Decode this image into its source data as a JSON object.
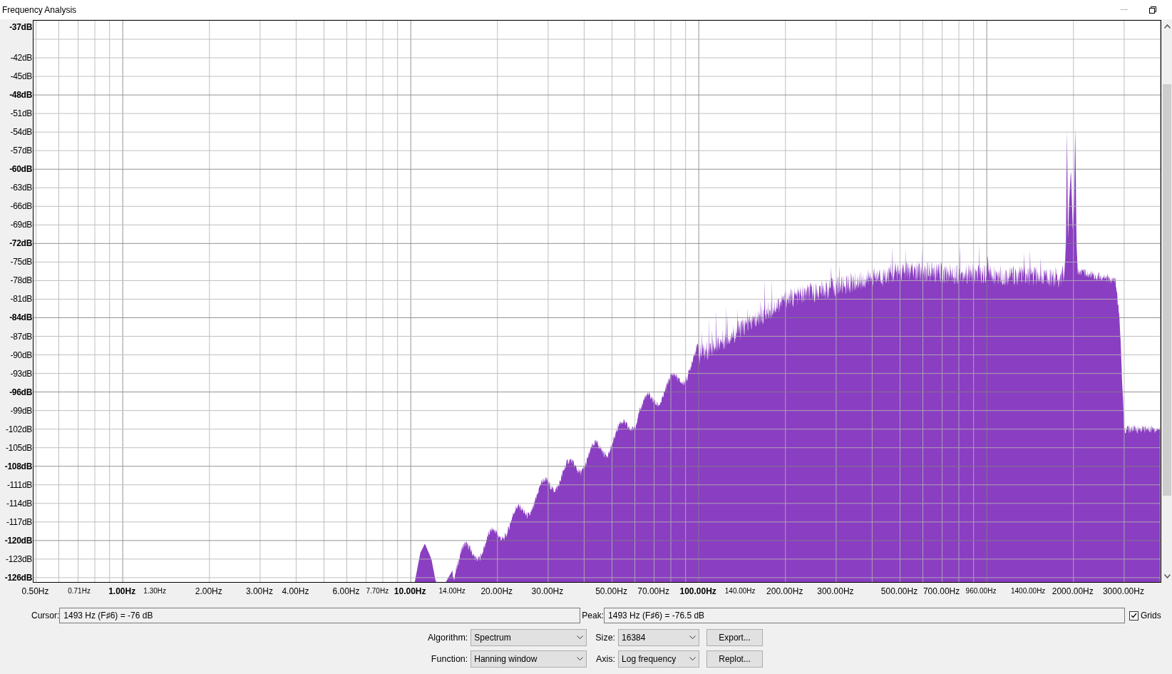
{
  "window": {
    "title": "Frequency Analysis"
  },
  "plot": {
    "y_axis_labels": [
      {
        "text": "-37dB",
        "bold": true
      },
      {
        "text": "-42dB",
        "bold": false
      },
      {
        "text": "-45dB",
        "bold": false
      },
      {
        "text": "-48dB",
        "bold": true
      },
      {
        "text": "-51dB",
        "bold": false
      },
      {
        "text": "-54dB",
        "bold": false
      },
      {
        "text": "-57dB",
        "bold": false
      },
      {
        "text": "-60dB",
        "bold": true
      },
      {
        "text": "-63dB",
        "bold": false
      },
      {
        "text": "-66dB",
        "bold": false
      },
      {
        "text": "-69dB",
        "bold": false
      },
      {
        "text": "-72dB",
        "bold": true
      },
      {
        "text": "-75dB",
        "bold": false
      },
      {
        "text": "-78dB",
        "bold": false
      },
      {
        "text": "-81dB",
        "bold": false
      },
      {
        "text": "-84dB",
        "bold": true
      },
      {
        "text": "-87dB",
        "bold": false
      },
      {
        "text": "-90dB",
        "bold": false
      },
      {
        "text": "-93dB",
        "bold": false
      },
      {
        "text": "-96dB",
        "bold": true
      },
      {
        "text": "-99dB",
        "bold": false
      },
      {
        "text": "-102dB",
        "bold": false
      },
      {
        "text": "-105dB",
        "bold": false
      },
      {
        "text": "-108dB",
        "bold": true
      },
      {
        "text": "-111dB",
        "bold": false
      },
      {
        "text": "-114dB",
        "bold": false
      },
      {
        "text": "-117dB",
        "bold": false
      },
      {
        "text": "-120dB",
        "bold": true
      },
      {
        "text": "-123dB",
        "bold": false
      },
      {
        "text": "-126dB",
        "bold": true
      }
    ],
    "x_axis_labels": [
      {
        "text": "0.50Hz",
        "kind": "normal"
      },
      {
        "text": "0.71Hz",
        "kind": "small"
      },
      {
        "text": "1.00Hz",
        "kind": "bold"
      },
      {
        "text": "1.30Hz",
        "kind": "small"
      },
      {
        "text": "2.00Hz",
        "kind": "normal"
      },
      {
        "text": "3.00Hz",
        "kind": "normal"
      },
      {
        "text": "4.00Hz",
        "kind": "normal"
      },
      {
        "text": "6.00Hz",
        "kind": "normal"
      },
      {
        "text": "7.70Hz",
        "kind": "small"
      },
      {
        "text": "10.00Hz",
        "kind": "bold"
      },
      {
        "text": "14.00Hz",
        "kind": "small"
      },
      {
        "text": "20.00Hz",
        "kind": "normal"
      },
      {
        "text": "30.00Hz",
        "kind": "normal"
      },
      {
        "text": "50.00Hz",
        "kind": "normal"
      },
      {
        "text": "70.00Hz",
        "kind": "normal"
      },
      {
        "text": "100.00Hz",
        "kind": "bold"
      },
      {
        "text": "140.00Hz",
        "kind": "small"
      },
      {
        "text": "200.00Hz",
        "kind": "normal"
      },
      {
        "text": "300.00Hz",
        "kind": "normal"
      },
      {
        "text": "500.00Hz",
        "kind": "normal"
      },
      {
        "text": "700.00Hz",
        "kind": "normal"
      },
      {
        "text": "960.00Hz",
        "kind": "small"
      },
      {
        "text": "1400.00Hz",
        "kind": "small"
      },
      {
        "text": "2000.00Hz",
        "kind": "normal"
      },
      {
        "text": "3000.00Hz",
        "kind": "normal"
      }
    ]
  },
  "readouts": {
    "cursor": {
      "label": "Cursor:",
      "value": "1493 Hz (F♯6) = -76 dB"
    },
    "peak": {
      "label": "Peak:",
      "value": "1493 Hz (F♯6) = -76.5 dB"
    },
    "grids": {
      "label": "Grids",
      "checked": true
    }
  },
  "settings": {
    "algorithm": {
      "label": "Algorithm:",
      "value": "Spectrum"
    },
    "size": {
      "label": "Size:",
      "value": "16384"
    },
    "function": {
      "label": "Function:",
      "value": "Hanning window"
    },
    "axis": {
      "label": "Axis:",
      "value": "Log frequency"
    },
    "buttons": [
      "Export...",
      "Replot..."
    ]
  }
}
